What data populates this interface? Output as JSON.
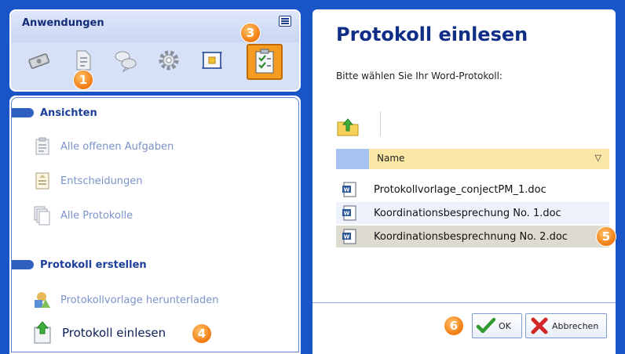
{
  "apps_panel": {
    "title": "Anwendungen",
    "icons": [
      "money-icon",
      "document-icon",
      "chat-icon",
      "gear-icon",
      "frame-icon",
      "checklist-icon"
    ],
    "selected_icon": "checklist-icon"
  },
  "callouts": [
    "1",
    "3",
    "4",
    "5",
    "6"
  ],
  "nav": {
    "section1": {
      "label": "Ansichten",
      "items": [
        "Alle offenen Aufgaben",
        "Entscheidungen",
        "Alle Protokolle"
      ]
    },
    "section2": {
      "label": "Protokoll erstellen",
      "items": [
        "Protokollvorlage herunterladen",
        "Protokoll einlesen"
      ]
    }
  },
  "panel": {
    "title": "Protokoll einlesen",
    "subtitle": "Bitte wählen Sie Ihr Word-Protokoll:",
    "column_name": "Name",
    "sort_glyph": "▽",
    "files": [
      "Protokollvorlage_conjectPM_1.doc",
      "Koordinationsbesprechung No. 1.doc",
      "Koordinationsbesprechnung No. 2.doc"
    ],
    "selected_file": "Koordinationsbesprechnung No. 2.doc"
  },
  "buttons": {
    "ok": "OK",
    "cancel": "Abbrechen"
  },
  "colors": {
    "background": "#1a55c8",
    "accent_orange": "#f59b22",
    "title_blue": "#102e86",
    "header_yellow": "#fbe7a6"
  }
}
